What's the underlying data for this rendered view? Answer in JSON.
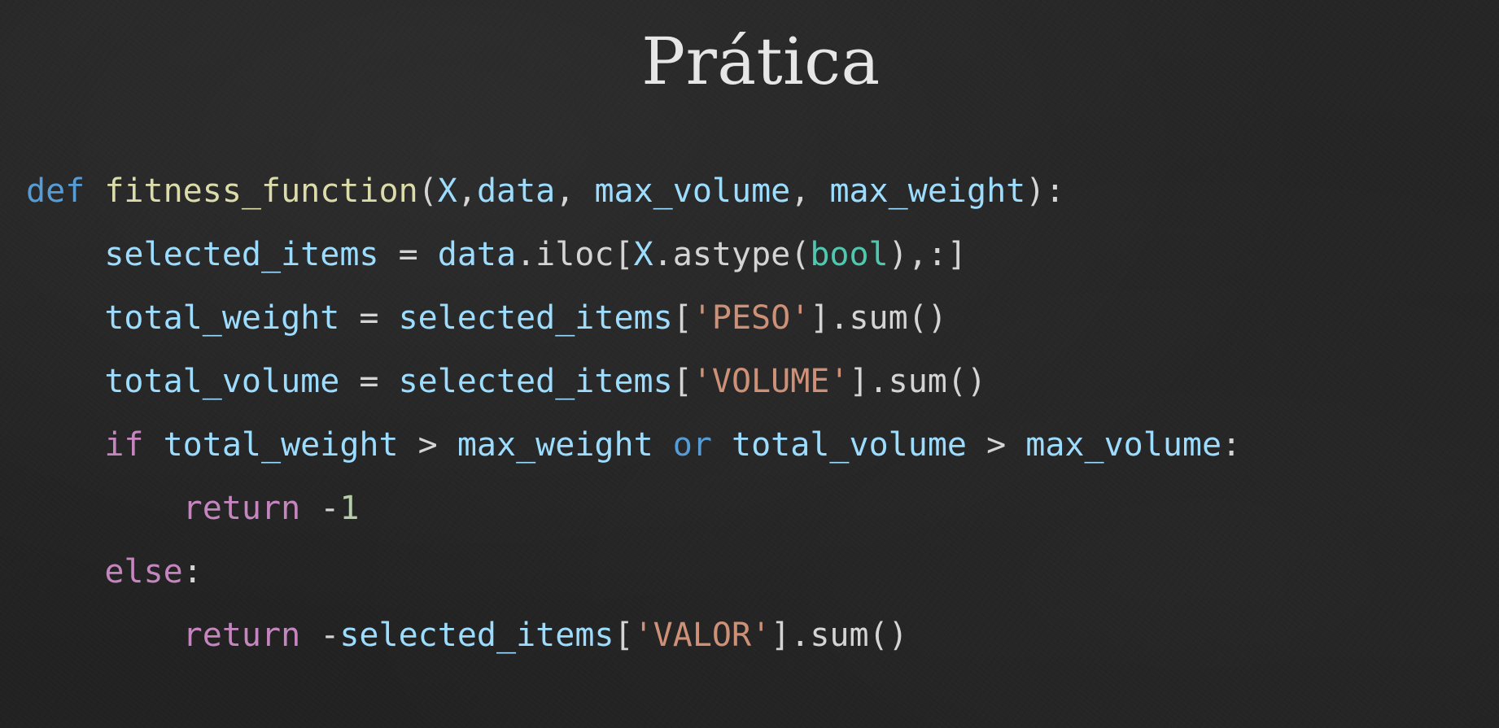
{
  "slide": {
    "title": "Prática"
  },
  "colors": {
    "background": "#242424",
    "keyword_blue": "#569cd6",
    "keyword_control": "#c586c0",
    "function_name": "#dcdcaa",
    "variable": "#9cdcfe",
    "builtin_type": "#4ec9b0",
    "string": "#ce9178",
    "number": "#b5cea8",
    "default": "#d4d4d4"
  },
  "code": {
    "language": "python",
    "lines": [
      {
        "indent": "",
        "tokens": [
          {
            "text": "def",
            "type": "keyword_blue"
          },
          {
            "text": " ",
            "type": "default"
          },
          {
            "text": "fitness_function",
            "type": "function_name"
          },
          {
            "text": "(",
            "type": "default"
          },
          {
            "text": "X",
            "type": "variable"
          },
          {
            "text": ",",
            "type": "default"
          },
          {
            "text": "data",
            "type": "variable"
          },
          {
            "text": ", ",
            "type": "default"
          },
          {
            "text": "max_volume",
            "type": "variable"
          },
          {
            "text": ", ",
            "type": "default"
          },
          {
            "text": "max_weight",
            "type": "variable"
          },
          {
            "text": "):",
            "type": "default"
          }
        ]
      },
      {
        "indent": "    ",
        "tokens": [
          {
            "text": "selected_items",
            "type": "variable"
          },
          {
            "text": " = ",
            "type": "default"
          },
          {
            "text": "data",
            "type": "variable"
          },
          {
            "text": ".iloc[",
            "type": "default"
          },
          {
            "text": "X",
            "type": "variable"
          },
          {
            "text": ".astype(",
            "type": "default"
          },
          {
            "text": "bool",
            "type": "builtin_type"
          },
          {
            "text": "),:]",
            "type": "default"
          }
        ]
      },
      {
        "indent": "    ",
        "tokens": [
          {
            "text": "total_weight",
            "type": "variable"
          },
          {
            "text": " = ",
            "type": "default"
          },
          {
            "text": "selected_items",
            "type": "variable"
          },
          {
            "text": "[",
            "type": "default"
          },
          {
            "text": "'PESO'",
            "type": "string"
          },
          {
            "text": "].sum()",
            "type": "default"
          }
        ]
      },
      {
        "indent": "    ",
        "tokens": [
          {
            "text": "total_volume",
            "type": "variable"
          },
          {
            "text": " = ",
            "type": "default"
          },
          {
            "text": "selected_items",
            "type": "variable"
          },
          {
            "text": "[",
            "type": "default"
          },
          {
            "text": "'VOLUME'",
            "type": "string"
          },
          {
            "text": "].sum()",
            "type": "default"
          }
        ]
      },
      {
        "indent": "    ",
        "tokens": [
          {
            "text": "if",
            "type": "keyword_control"
          },
          {
            "text": " ",
            "type": "default"
          },
          {
            "text": "total_weight",
            "type": "variable"
          },
          {
            "text": " > ",
            "type": "default"
          },
          {
            "text": "max_weight",
            "type": "variable"
          },
          {
            "text": " ",
            "type": "default"
          },
          {
            "text": "or",
            "type": "keyword_blue"
          },
          {
            "text": " ",
            "type": "default"
          },
          {
            "text": "total_volume",
            "type": "variable"
          },
          {
            "text": " > ",
            "type": "default"
          },
          {
            "text": "max_volume",
            "type": "variable"
          },
          {
            "text": ":",
            "type": "default"
          }
        ]
      },
      {
        "indent": "        ",
        "tokens": [
          {
            "text": "return",
            "type": "keyword_control"
          },
          {
            "text": " -",
            "type": "default"
          },
          {
            "text": "1",
            "type": "number"
          }
        ]
      },
      {
        "indent": "    ",
        "tokens": [
          {
            "text": "else",
            "type": "keyword_control"
          },
          {
            "text": ":",
            "type": "default"
          }
        ]
      },
      {
        "indent": "        ",
        "tokens": [
          {
            "text": "return",
            "type": "keyword_control"
          },
          {
            "text": " -",
            "type": "default"
          },
          {
            "text": "selected_items",
            "type": "variable"
          },
          {
            "text": "[",
            "type": "default"
          },
          {
            "text": "'VALOR'",
            "type": "string"
          },
          {
            "text": "].sum()",
            "type": "default"
          }
        ]
      }
    ]
  }
}
